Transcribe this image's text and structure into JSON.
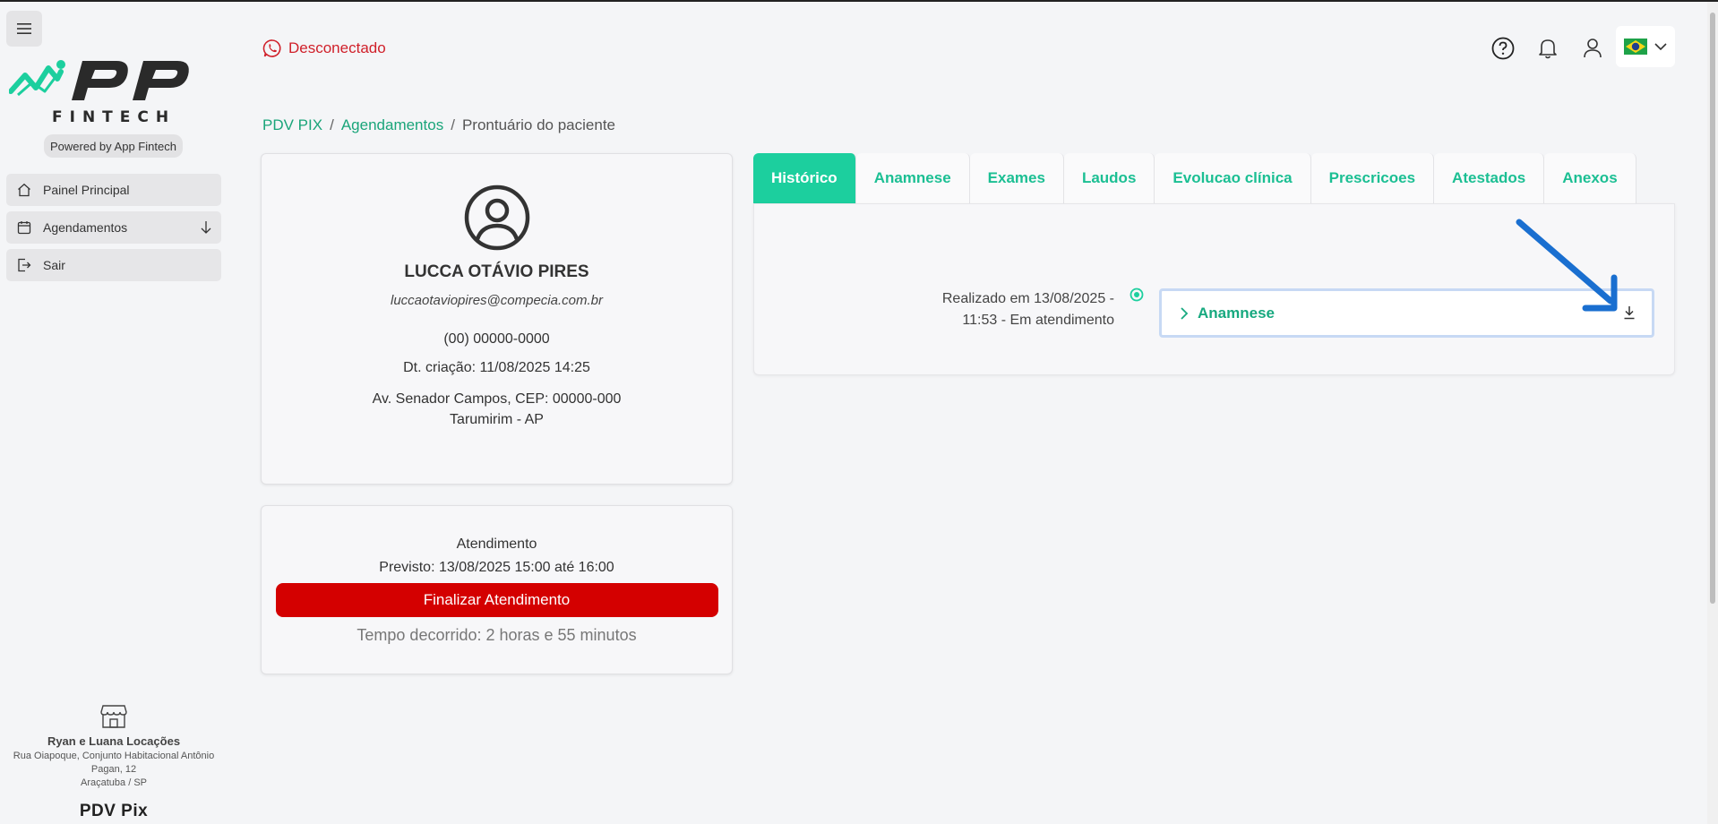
{
  "sidebar": {
    "logo_text": "APP",
    "logo_sub": "FINTECH",
    "powered_by": "Powered by App Fintech",
    "items": [
      {
        "label": "Painel Principal",
        "icon": "home-icon"
      },
      {
        "label": "Agendamentos",
        "icon": "calendar-icon"
      },
      {
        "label": "Sair",
        "icon": "logout-icon"
      }
    ],
    "company": {
      "name": "Ryan e Luana Locações",
      "address_line1": "Rua Oiapoque, Conjunto Habitacional Antônio",
      "address_line2": "Pagan, 12",
      "city": "Araçatuba / SP"
    },
    "product": "PDV Pix"
  },
  "header": {
    "whatsapp_status": "Desconectado",
    "status_color": "#d0202a"
  },
  "breadcrumb": {
    "items": [
      "PDV PIX",
      "Agendamentos",
      "Prontuário do paciente"
    ],
    "separator": "/"
  },
  "patient": {
    "name": "LUCCA OTÁVIO PIRES",
    "email": "luccaotaviopires@compecia.com.br",
    "phone": "(00) 00000-0000",
    "created": "Dt. criação: 11/08/2025 14:25",
    "address_line1": "Av. Senador Campos, CEP: 00000-000",
    "address_line2": "Tarumirim - AP"
  },
  "appointment": {
    "title": "Atendimento",
    "scheduled": "Previsto: 13/08/2025 15:00 até 16:00",
    "finish_button": "Finalizar Atendimento",
    "elapsed": "Tempo decorrido: 2 horas e 55 minutos"
  },
  "tabs": [
    "Histórico",
    "Anamnese",
    "Exames",
    "Laudos",
    "Evolucao clínica",
    "Prescricoes",
    "Atestados",
    "Anexos"
  ],
  "active_tab": "Histórico",
  "history": {
    "label_line1": "Realizado em  13/08/2025 -",
    "label_line2": "11:53 - Em atendimento",
    "item_title": "Anamnese"
  },
  "colors": {
    "accent": "#1ccf9e",
    "link": "#1aa57a",
    "danger": "#d40000",
    "annotation": "#1a6fd0"
  }
}
